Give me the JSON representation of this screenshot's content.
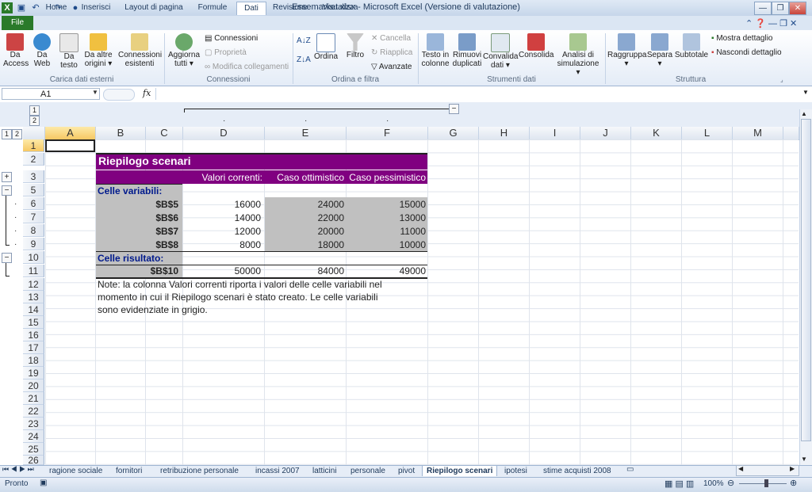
{
  "window": {
    "title": "Essemarket.xlsx - Microsoft Excel (Versione di valutazione)"
  },
  "tabs": [
    "File",
    "Home",
    "Inserisci",
    "Layout di pagina",
    "Formule",
    "Dati",
    "Revisione",
    "Visualizza"
  ],
  "ribbon": {
    "groups": [
      "Carica dati esterni",
      "Connessioni",
      "Ordina e filtra",
      "Strumenti dati",
      "Struttura"
    ],
    "carica": [
      [
        "Da",
        "Access"
      ],
      [
        "Da",
        "Web"
      ],
      [
        "Da",
        "testo"
      ],
      [
        "Da altre",
        "origini ▾"
      ],
      [
        "Connessioni",
        "esistenti"
      ]
    ],
    "aggiorna": [
      "Aggiorna",
      "tutti ▾"
    ],
    "connessioni_items": [
      "Connessioni",
      "Proprietà",
      "Modifica collegamenti"
    ],
    "ordina": "Ordina",
    "filtro": "Filtro",
    "filtro_items": [
      "Cancella",
      "Riapplica",
      "Avanzate"
    ],
    "strumenti": [
      [
        "Testo in",
        "colonne"
      ],
      [
        "Rimuovi",
        "duplicati"
      ],
      [
        "Convalida",
        "dati ▾"
      ],
      [
        "Consolida",
        ""
      ],
      [
        "Analisi di",
        "simulazione ▾"
      ]
    ],
    "struttura": [
      [
        "Raggruppa",
        "▾"
      ],
      [
        "Separa",
        "▾"
      ],
      [
        "Subtotale",
        ""
      ]
    ],
    "struttura_items": [
      "Mostra dettaglio",
      "Nascondi dettaglio"
    ]
  },
  "formula_bar": {
    "name_box": "A1",
    "fx": "fx",
    "value": ""
  },
  "outline": {
    "col_levels": [
      "1",
      "2"
    ],
    "row_levels": [
      "1",
      "2"
    ]
  },
  "columns": [
    "A",
    "B",
    "C",
    "D",
    "E",
    "F",
    "G",
    "H",
    "I",
    "J",
    "K",
    "L",
    "M"
  ],
  "rows": [
    "1",
    "2",
    "3",
    "5",
    "6",
    "7",
    "8",
    "9",
    "10",
    "11",
    "12",
    "13",
    "14",
    "15",
    "16",
    "17",
    "18",
    "19",
    "20",
    "21",
    "22",
    "23",
    "24",
    "25",
    "26"
  ],
  "scenario": {
    "title": "Riepilogo scenari",
    "headers": [
      "Valori correnti:",
      "Caso ottimistico",
      "Caso pessimistico"
    ],
    "variable_label": "Celle variabili:",
    "variables": [
      {
        "ref": "$B$5",
        "values": [
          "16000",
          "24000",
          "15000"
        ]
      },
      {
        "ref": "$B$6",
        "values": [
          "14000",
          "22000",
          "13000"
        ]
      },
      {
        "ref": "$B$7",
        "values": [
          "12000",
          "20000",
          "11000"
        ]
      },
      {
        "ref": "$B$8",
        "values": [
          "8000",
          "18000",
          "10000"
        ]
      }
    ],
    "result_label": "Celle risultato:",
    "result": {
      "ref": "$B$10",
      "values": [
        "50000",
        "84000",
        "49000"
      ]
    },
    "note": [
      "Note: la colonna Valori correnti riporta i valori delle celle variabili nel",
      "momento in cui il Riepilogo scenari è stato creato. Le celle variabili",
      "sono evidenziate in grigio."
    ]
  },
  "sheet_tabs": [
    "ragione sociale",
    "fornitori",
    "retribuzione personale",
    "incassi 2007",
    "latticini",
    "personale",
    "pivot",
    "Riepilogo scenari",
    "ipotesi",
    "stime acquisti 2008"
  ],
  "active_sheet": "Riepilogo scenari",
  "status": {
    "mode": "Pronto",
    "zoom": "100%"
  },
  "colors": {
    "accent": "#800080",
    "grey": "#c0c0c0",
    "file_tab": "#2a7a2a"
  }
}
